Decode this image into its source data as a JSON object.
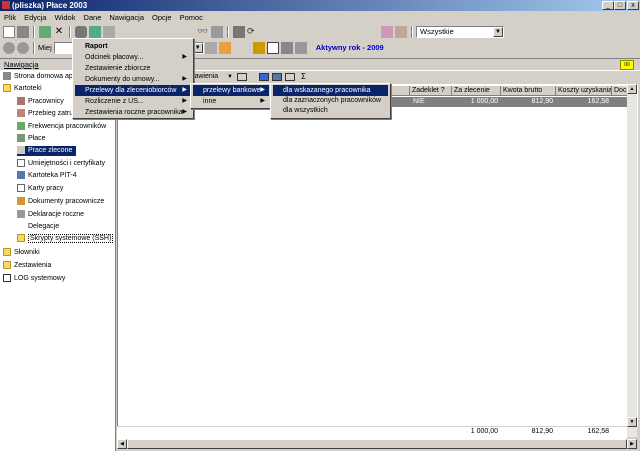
{
  "window": {
    "title": "(pliszka)  Płace 2003",
    "min": "_",
    "max": "□",
    "close": "x"
  },
  "menubar": [
    "Plik",
    "Edycja",
    "Widok",
    "Dane",
    "Nawigacja",
    "Opcje",
    "Pomoc"
  ],
  "toolbar": {
    "filter_value": "Wszystkie",
    "address_label": "Miej",
    "active_year": "Aktywny rok - 2009"
  },
  "navigation": {
    "label": "Nawigacja",
    "badge": "00",
    "items": [
      {
        "label": "Strona domowa ap",
        "indent": 0
      },
      {
        "label": "Kartoteki",
        "indent": 0
      },
      {
        "label": "Pracownicy",
        "indent": 1
      },
      {
        "label": "Przebieg zatru",
        "indent": 1
      },
      {
        "label": "Frekwencja pracowników",
        "indent": 1
      },
      {
        "label": "Płace",
        "indent": 1
      },
      {
        "label": "Prace zlecone",
        "indent": 1,
        "selected": true
      },
      {
        "label": "Umiejętności i certyfikaty",
        "indent": 1
      },
      {
        "label": "Kartoteka PIT-4",
        "indent": 1
      },
      {
        "label": "Karty pracy",
        "indent": 1
      },
      {
        "label": "Dokumenty pracownicze",
        "indent": 1
      },
      {
        "label": "Deklaracje roczne",
        "indent": 1
      },
      {
        "label": "Delegacje",
        "indent": 1
      },
      {
        "label": "Skrypty systemowe (SSH)",
        "indent": 1
      },
      {
        "label": "Słowniki",
        "indent": 0
      },
      {
        "label": "Zestawienia",
        "indent": 0
      },
      {
        "label": "LOG systemowy",
        "indent": 0
      }
    ]
  },
  "grid": {
    "toolbar_label": "stawienia",
    "sigma": "Σ",
    "columns": [
      "Zadeklet ?",
      "Za zlecenie",
      "Kwota brutto",
      "Koszty uzyskania",
      "Dochód"
    ],
    "row": [
      "NIE",
      "1 000,00",
      "812,90",
      "162,58",
      ""
    ],
    "totals": [
      "1 000,00",
      "812,90",
      "162,58"
    ]
  },
  "menu_main": {
    "items": [
      "Raport",
      "Odcinek płacowy...",
      "Zestawienie zbiorcze",
      "Dokumenty do umowy...",
      "Przelewy dla zleceniobiorców",
      "Rozliczenie z US...",
      "Zestawienia roczne pracownika"
    ]
  },
  "menu_sub1": {
    "items": [
      "przelewy bankowe",
      "inne"
    ]
  },
  "menu_sub2": {
    "items": [
      "dla wskazanego pracownika",
      "dla zaznaczonych pracowników",
      "dla wszystkich"
    ]
  }
}
